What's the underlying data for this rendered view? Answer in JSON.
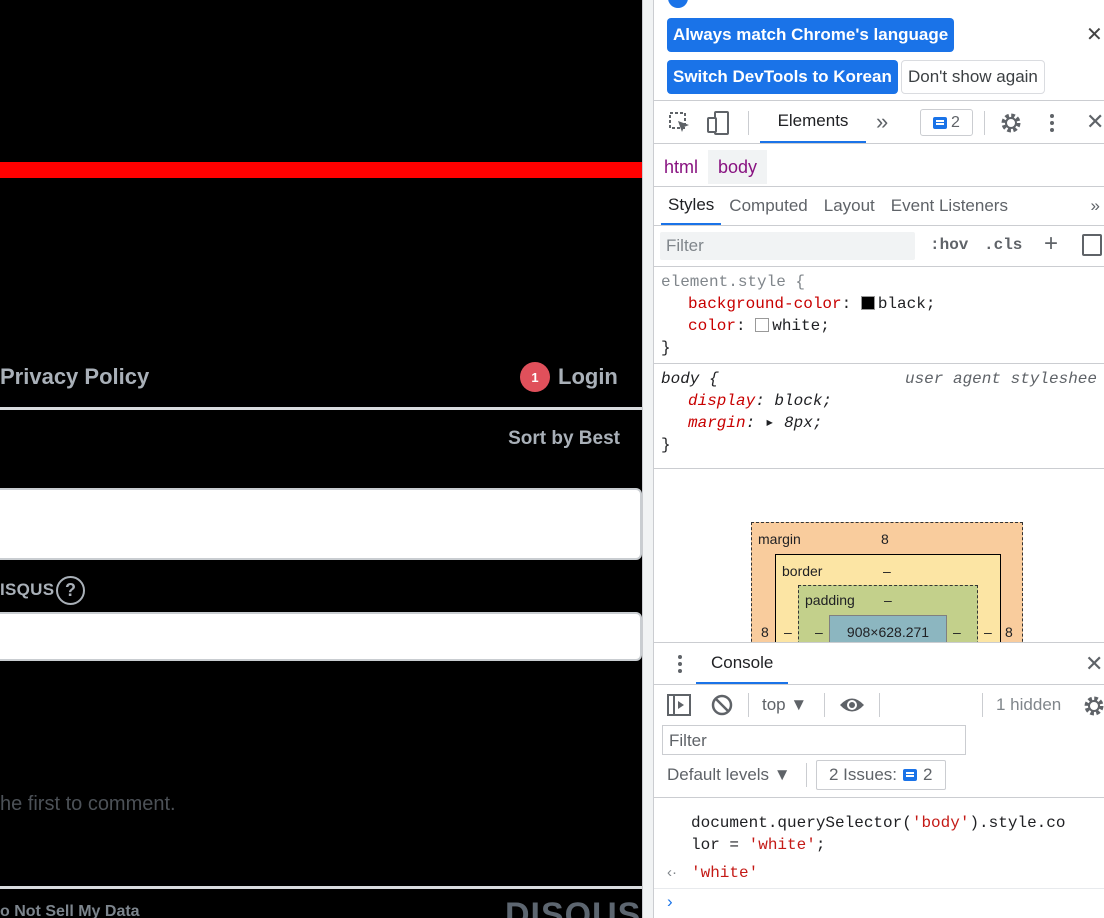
{
  "page": {
    "nav_privacy": "Privacy Policy",
    "login_badge": "1",
    "login_label": "Login",
    "sort_label": "Sort by Best",
    "disqus_label": "ISQUS",
    "help_glyph": "?",
    "empty_message": "he first to comment.",
    "do_not_sell": "o Not Sell My Data",
    "logo_text": "DISQUS",
    "colors": {
      "accent_bar": "#ff0000",
      "badge": "#e0505b"
    }
  },
  "devtools": {
    "banner": {
      "match_language": "Always match Chrome's language",
      "switch_korean": "Switch DevTools to Korean",
      "dont_show": "Don't show again",
      "close_glyph": "✕"
    },
    "toolbar": {
      "elements_tab": "Elements",
      "more_tabs_glyph": "»",
      "issues_count": "2"
    },
    "breadcrumbs": [
      "html",
      "body"
    ],
    "styles_tabs": [
      "Styles",
      "Computed",
      "Layout",
      "Event Listeners"
    ],
    "styles_filter_placeholder": "Filter",
    "hov": ":hov",
    "cls": ".cls",
    "rules": {
      "element_selector": "element.style {",
      "bg_prop": "background-color",
      "bg_val": "black;",
      "color_prop": "color",
      "color_val": "white;",
      "close_brace": "}",
      "body_selector": "body {",
      "ua_source": "user agent styleshee",
      "display_prop": "display",
      "display_val": "block;",
      "margin_prop": "margin",
      "margin_val": "8px;"
    },
    "box_model": {
      "margin_label": "margin",
      "margin_value": "8",
      "border_label": "border",
      "border_value": "–",
      "padding_label": "padding",
      "padding_value": "–",
      "content": "908×628.271",
      "left_margin": "8",
      "right_margin": "8",
      "dash": "–"
    },
    "drawer": {
      "console_tab": "Console",
      "context": "top ▼",
      "hidden": "1 hidden",
      "filter_placeholder": "Filter",
      "levels": "Default levels ▼",
      "issues_label": "2 Issues:",
      "issues_count": "2",
      "command": "document.querySelector('body').style.co\nlor = 'white';",
      "result": "'white'"
    }
  }
}
